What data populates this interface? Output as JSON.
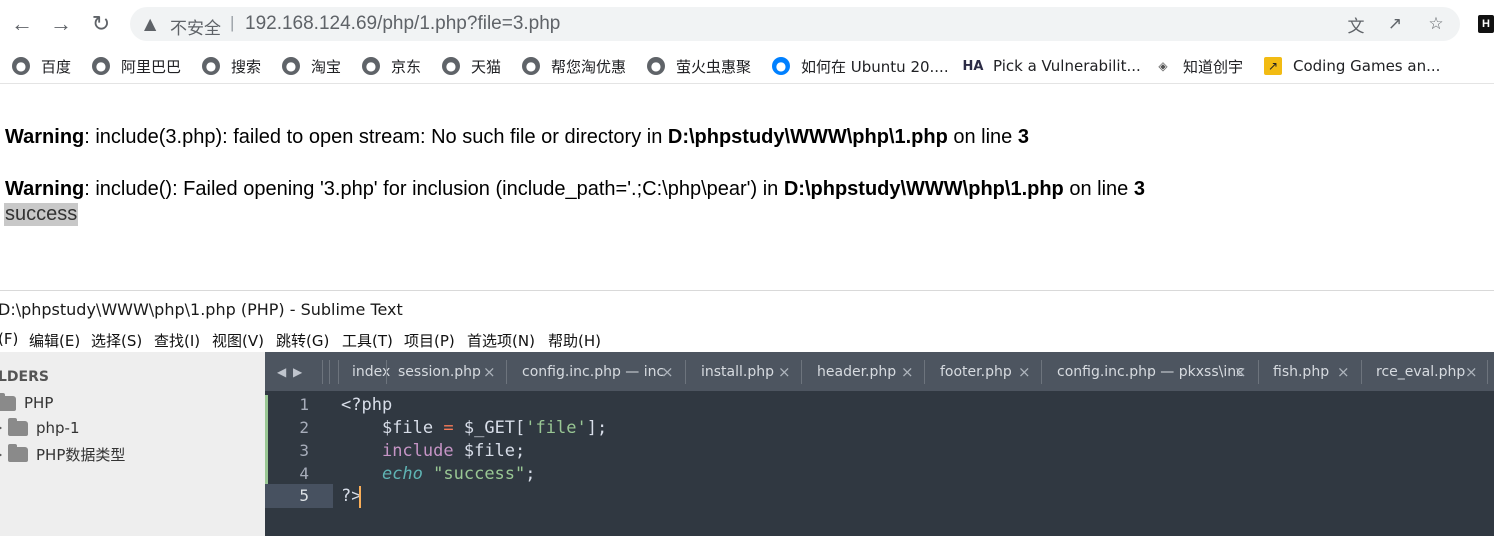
{
  "browser": {
    "insecure_label": "不安全",
    "url": "192.168.124.69/php/1.php?file=3.php",
    "profile_letter": "H"
  },
  "bookmarks": [
    {
      "label": "百度",
      "icon": "globe-icon"
    },
    {
      "label": "阿里巴巴",
      "icon": "globe-icon"
    },
    {
      "label": "搜索",
      "icon": "globe-icon"
    },
    {
      "label": "淘宝",
      "icon": "globe-icon"
    },
    {
      "label": "京东",
      "icon": "globe-icon"
    },
    {
      "label": "天猫",
      "icon": "globe-icon"
    },
    {
      "label": "帮您淘优惠",
      "icon": "globe-icon"
    },
    {
      "label": "萤火虫惠聚",
      "icon": "globe-icon"
    },
    {
      "label": "如何在 Ubuntu 20....",
      "icon": "digitalocean-icon"
    },
    {
      "label": "Pick a Vulnerabilit...",
      "icon": "hackerone-icon"
    },
    {
      "label": "知道创宇",
      "icon": "knownsec-icon"
    },
    {
      "label": "Coding Games an...",
      "icon": "codingame-icon"
    }
  ],
  "page": {
    "warning1": {
      "label": "Warning",
      "msg": ": include(3.php): failed to open stream: No such file or directory in ",
      "path": "D:\\phpstudy\\WWW\\php\\1.php",
      "online": " on line ",
      "line": "3"
    },
    "warning2": {
      "label": "Warning",
      "msg": ": include(): Failed opening '3.php' for inclusion (include_path='.;C:\\php\\pear') in ",
      "path": "D:\\phpstudy\\WWW\\php\\1.php",
      "online": " on line ",
      "line": "3"
    },
    "output": "success"
  },
  "sublime": {
    "title": "D:\\phpstudy\\WWW\\php\\1.php (PHP) - Sublime Text",
    "menu": [
      "(F)",
      "编辑(E)",
      "选择(S)",
      "查找(I)",
      "视图(V)",
      "跳转(G)",
      "工具(T)",
      "项目(P)",
      "首选项(N)",
      "帮助(H)"
    ],
    "sidebar": {
      "header": "LDERS",
      "root": "PHP",
      "children": [
        "php-1",
        "PHP数据类型"
      ]
    },
    "tabs": [
      "index",
      "session.php",
      "config.inc.php — inc",
      "install.php",
      "header.php",
      "footer.php",
      "config.inc.php — pkxss\\inc",
      "fish.php",
      "rce_eval.php"
    ],
    "line_numbers": [
      "1",
      "2",
      "3",
      "4",
      "5"
    ],
    "code": {
      "l1": "<?php",
      "l2_var": "$file",
      "l2_eq": " = ",
      "l2_get": "$_GET[",
      "l2_key": "'file'",
      "l2_end": "];",
      "l3_kw": "include",
      "l3_var": " $file",
      "l3_end": ";",
      "l4_fn": "echo",
      "l4_str": " \"success\"",
      "l4_end": ";",
      "l5": "?>"
    }
  }
}
